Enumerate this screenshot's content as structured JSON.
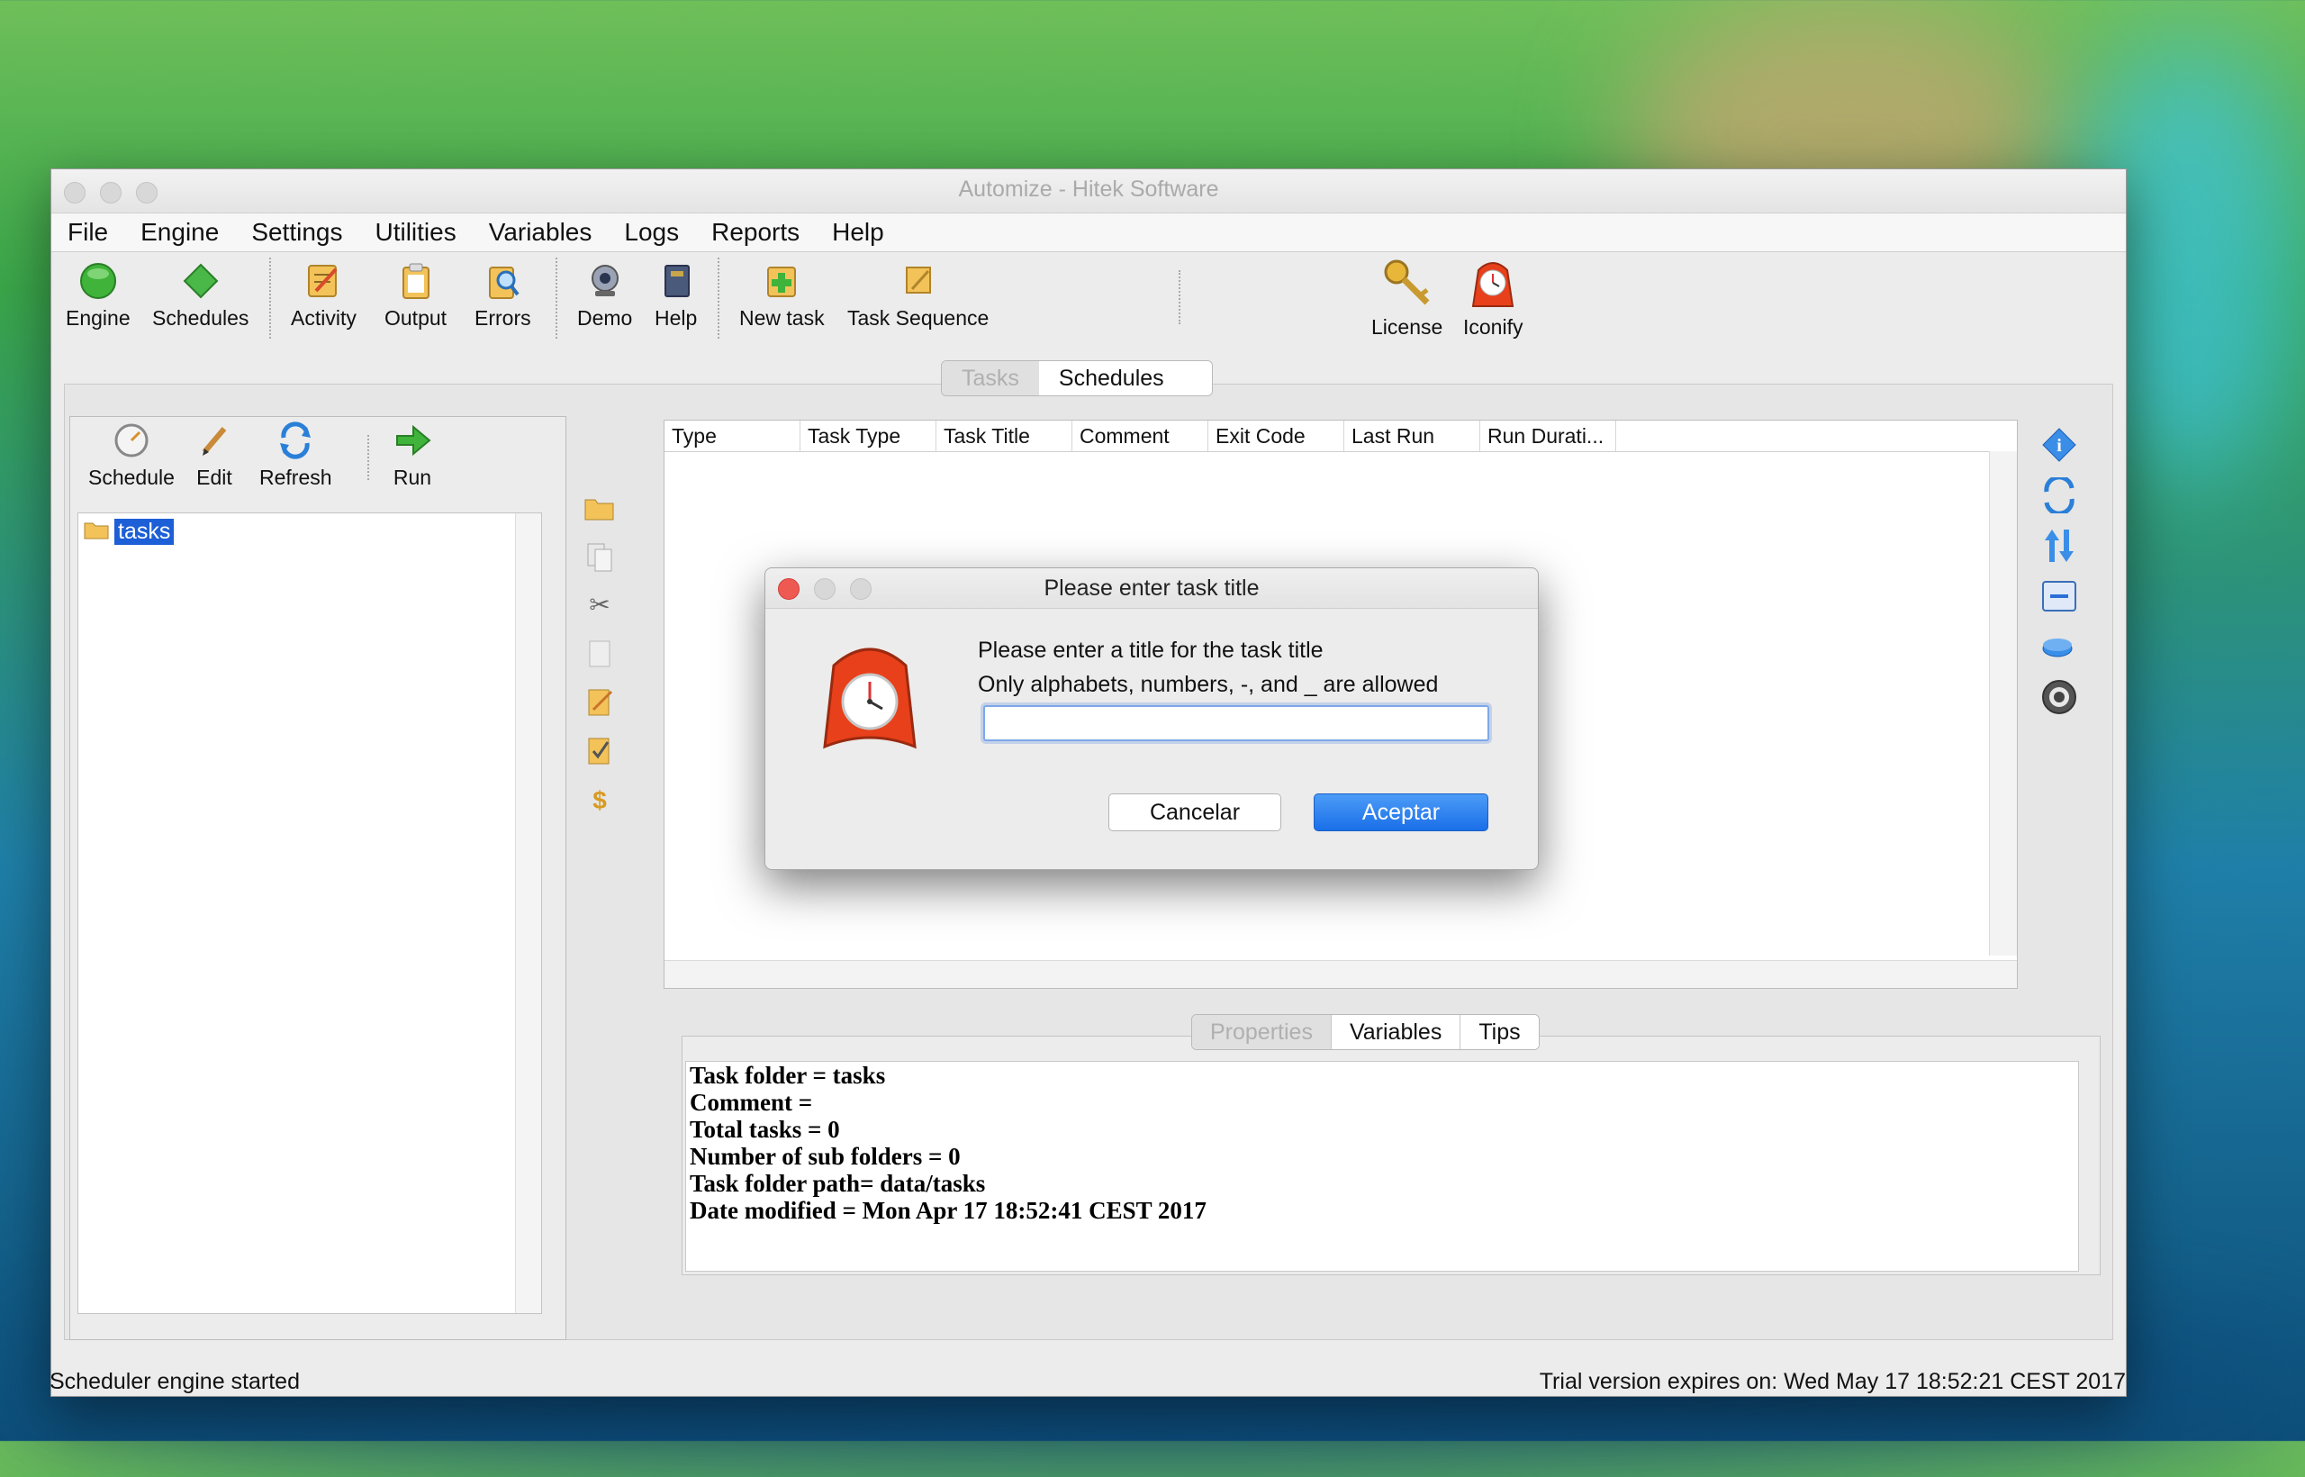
{
  "window": {
    "title": "Automize     - Hitek Software"
  },
  "menubar": [
    "File",
    "Engine",
    "Settings",
    "Utilities",
    "Variables",
    "Logs",
    "Reports",
    "Help"
  ],
  "toolbar": {
    "engine": "Engine",
    "schedules": "Schedules",
    "activity": "Activity",
    "output": "Output",
    "errors": "Errors",
    "demo": "Demo",
    "help": "Help",
    "new_task": "New task",
    "task_sequence": "Task Sequence",
    "license": "License",
    "iconify": "Iconify"
  },
  "main_tabs": [
    "Tasks",
    "Schedules"
  ],
  "left_toolbar": {
    "schedule": "Schedule",
    "edit": "Edit",
    "refresh": "Refresh",
    "run": "Run"
  },
  "tree": {
    "root": "tasks"
  },
  "table": {
    "columns": [
      "Type",
      "Task Type",
      "Task Title",
      "Comment",
      "Exit Code",
      "Last Run",
      "Run Durati..."
    ]
  },
  "bottom_tabs": [
    "Properties",
    "Variables",
    "Tips"
  ],
  "properties": [
    "Task folder = tasks",
    "Comment =",
    "Total tasks = 0",
    "Number of sub folders = 0",
    "Task folder path= data/tasks",
    "Date modified = Mon Apr 17 18:52:41 CEST 2017"
  ],
  "status": {
    "left": "Scheduler engine started",
    "right": "Trial version expires on: Wed May 17 18:52:21 CEST 2017"
  },
  "dialog": {
    "title": "Please enter task title",
    "message_line1": "Please enter a title for the task title",
    "message_line2": "Only alphabets, numbers, -, and _ are allowed",
    "input_value": "",
    "cancel": "Cancelar",
    "ok": "Aceptar"
  },
  "colors": {
    "accent_blue": "#1a6fe8",
    "selection_blue": "#1c5fd6",
    "close_red": "#ee5a52"
  }
}
